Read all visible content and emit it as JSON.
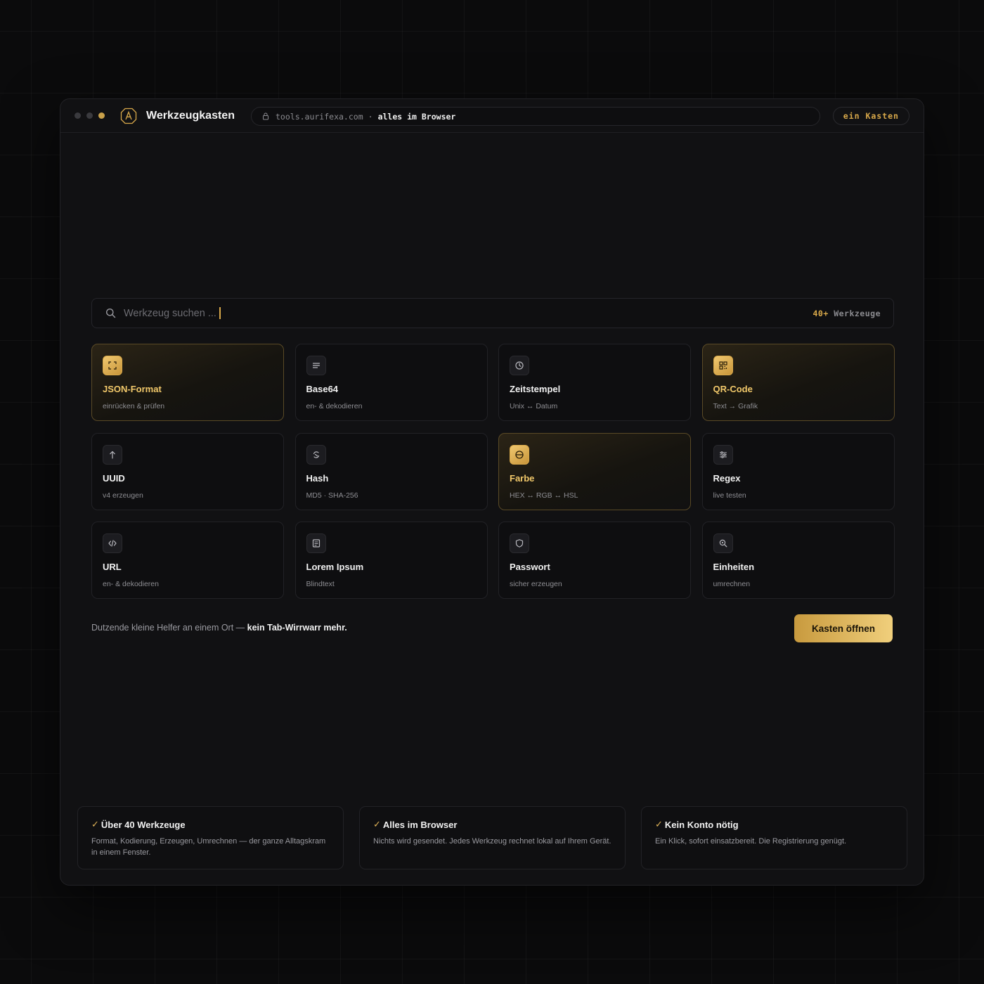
{
  "window": {
    "title": "Werkzeugkasten",
    "url_host": "tools.aurifexa.com",
    "url_separator": "·",
    "url_note": "alles im Browser",
    "badge": "ein Kasten"
  },
  "search": {
    "placeholder": "Werkzeug suchen ...",
    "count_num": "40+",
    "count_label": "Werkzeuge"
  },
  "tools": [
    {
      "name": "JSON-Format",
      "desc": "einrücken & prüfen",
      "icon": "expand-icon",
      "highlighted": true
    },
    {
      "name": "Base64",
      "desc": "en- & dekodieren",
      "icon": "lines-icon",
      "highlighted": false
    },
    {
      "name": "Zeitstempel",
      "desc": "Unix ↔ Datum",
      "icon": "clock-icon",
      "highlighted": false
    },
    {
      "name": "QR-Code",
      "desc": "Text → Grafik",
      "icon": "qr-icon",
      "highlighted": true
    },
    {
      "name": "UUID",
      "desc": "v4 erzeugen",
      "icon": "arrow-up-icon",
      "highlighted": false
    },
    {
      "name": "Hash",
      "desc": "MD5 · SHA-256",
      "icon": "hash-swirl-icon",
      "highlighted": false
    },
    {
      "name": "Farbe",
      "desc": "HEX ↔ RGB ↔ HSL",
      "icon": "color-circle-icon",
      "highlighted": true
    },
    {
      "name": "Regex",
      "desc": "live testen",
      "icon": "sliders-icon",
      "highlighted": false
    },
    {
      "name": "URL",
      "desc": "en- & dekodieren",
      "icon": "code-icon",
      "highlighted": false
    },
    {
      "name": "Lorem Ipsum",
      "desc": "Blindtext",
      "icon": "document-icon",
      "highlighted": false
    },
    {
      "name": "Passwort",
      "desc": "sicher erzeugen",
      "icon": "shield-icon",
      "highlighted": false
    },
    {
      "name": "Einheiten",
      "desc": "umrechnen",
      "icon": "zoom-icon",
      "highlighted": false
    }
  ],
  "tagline": {
    "text": "Dutzende kleine Helfer an einem Ort —",
    "bold": "kein Tab-Wirrwarr mehr."
  },
  "cta": {
    "label": "Kasten öffnen"
  },
  "features": [
    {
      "check": "✓",
      "title": "Über 40 Werkzeuge",
      "text": "Format, Kodierung, Erzeugen, Umrechnen — der ganze Alltagskram in einem Fenster."
    },
    {
      "check": "✓",
      "title": "Alles im Browser",
      "text": "Nichts wird gesendet. Jedes Werkzeug rechnet lokal auf Ihrem Gerät."
    },
    {
      "check": "✓",
      "title": "Kein Konto nötig",
      "text": "Ein Klick, sofort einsatzbereit. Die Registrierung genügt."
    }
  ],
  "colors": {
    "accent": "#d9a94a",
    "background": "#0b0b0c",
    "panel": "#111113"
  }
}
